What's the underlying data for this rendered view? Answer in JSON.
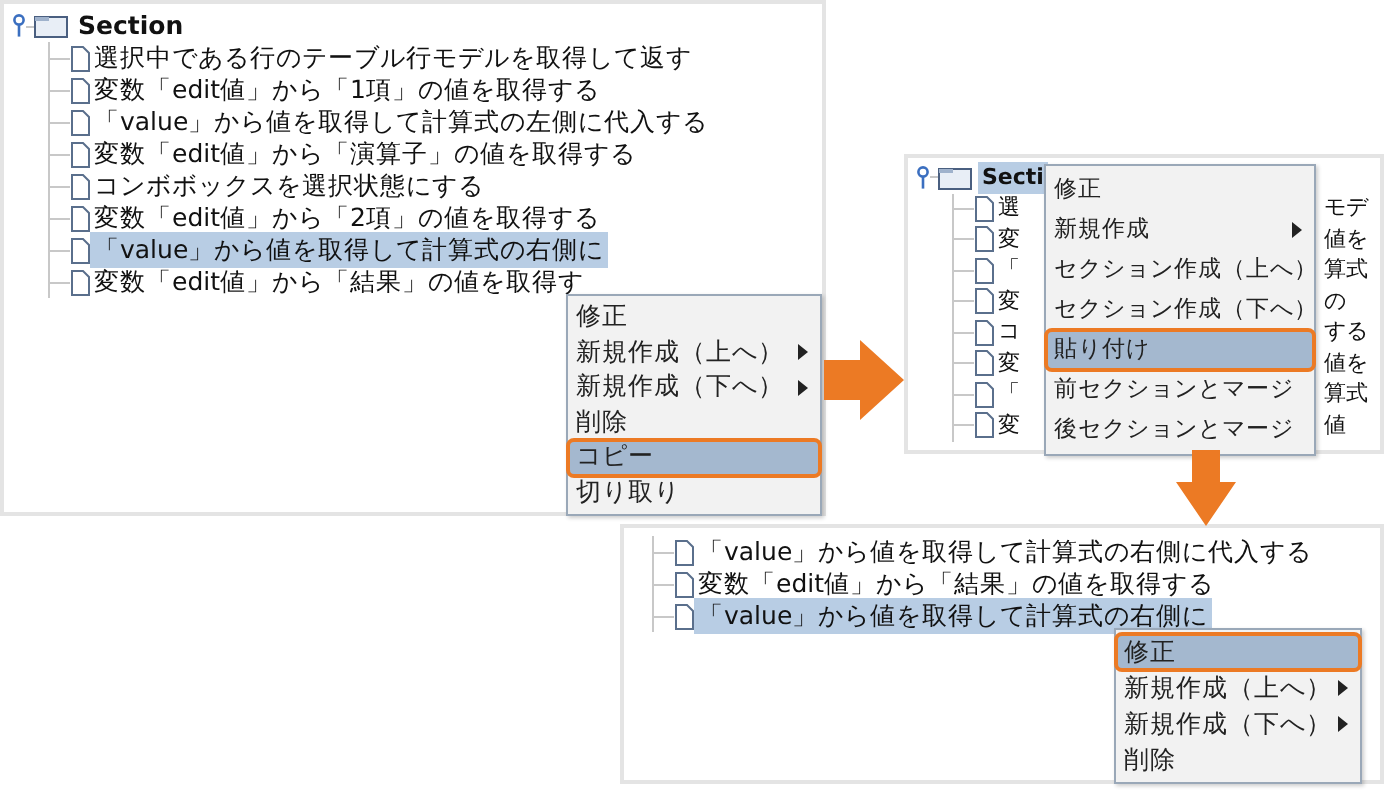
{
  "panels": [
    {
      "tree": {
        "root": {
          "label": "Section",
          "selected": false
        },
        "children": [
          {
            "label": "選択中である行のテーブル行モデルを取得して返す",
            "selected": false
          },
          {
            "label": "変数「edit値」から「1項」の値を取得する",
            "selected": false
          },
          {
            "label": "「value」から値を取得して計算式の左側に代入する",
            "selected": false
          },
          {
            "label": "変数「edit値」から「演算子」の値を取得する",
            "selected": false
          },
          {
            "label": "コンボボックスを選択状態にする",
            "selected": false
          },
          {
            "label": "変数「edit値」から「2項」の値を取得する",
            "selected": false
          },
          {
            "label": "「value」から値を取得して計算式の右側に",
            "selected": true
          },
          {
            "label": "変数「edit値」から「結果」の値を取得す",
            "selected": false
          }
        ]
      },
      "context_menu": {
        "items": [
          {
            "label": "修正",
            "submenu": false,
            "selected": false,
            "outlined": false
          },
          {
            "label": "新規作成（上へ）",
            "submenu": true,
            "selected": false,
            "outlined": false
          },
          {
            "label": "新規作成（下へ）",
            "submenu": true,
            "selected": false,
            "outlined": false
          },
          {
            "label": "削除",
            "submenu": false,
            "selected": false,
            "outlined": false
          },
          {
            "label": "コピー",
            "submenu": false,
            "selected": true,
            "outlined": true
          },
          {
            "label": "切り取り",
            "submenu": false,
            "selected": false,
            "outlined": false
          }
        ]
      }
    },
    {
      "tree": {
        "root": {
          "segments": [
            "Secti"
          ],
          "selected": true
        },
        "children": [
          {
            "segments": [
              "選",
              "モデ"
            ],
            "selected": false
          },
          {
            "segments": [
              "変",
              "値を"
            ],
            "selected": false
          },
          {
            "segments": [
              "「",
              "算式"
            ],
            "selected": false
          },
          {
            "segments": [
              "変",
              "の"
            ],
            "selected": false
          },
          {
            "segments": [
              "コ",
              "する"
            ],
            "selected": false
          },
          {
            "segments": [
              "変",
              "値を"
            ],
            "selected": false
          },
          {
            "segments": [
              "「",
              "算式"
            ],
            "selected": false
          },
          {
            "segments": [
              "変",
              "値"
            ],
            "selected": false
          }
        ]
      },
      "context_menu": {
        "items": [
          {
            "label": "修正",
            "submenu": false,
            "selected": false,
            "outlined": false
          },
          {
            "label": "新規作成",
            "submenu": true,
            "selected": false,
            "outlined": false
          },
          {
            "label": "セクション作成（上へ）",
            "submenu": false,
            "selected": false,
            "outlined": false
          },
          {
            "label": "セクション作成（下へ）",
            "submenu": false,
            "selected": false,
            "outlined": false
          },
          {
            "label": "貼り付け",
            "submenu": false,
            "selected": true,
            "outlined": true
          },
          {
            "label": "前セクションとマージ",
            "submenu": false,
            "selected": false,
            "outlined": false
          },
          {
            "label": "後セクションとマージ",
            "submenu": false,
            "selected": false,
            "outlined": false
          }
        ]
      }
    },
    {
      "tree": {
        "children": [
          {
            "label": "「value」から値を取得して計算式の右側に代入する",
            "selected": false
          },
          {
            "label": "変数「edit値」から「結果」の値を取得する",
            "selected": false
          },
          {
            "label": "「value」から値を取得して計算式の右側に",
            "selected": true
          }
        ]
      },
      "context_menu": {
        "items": [
          {
            "label": "修正",
            "submenu": false,
            "selected": true,
            "outlined": true
          },
          {
            "label": "新規作成（上へ）",
            "submenu": true,
            "selected": false,
            "outlined": false
          },
          {
            "label": "新規作成（下へ）",
            "submenu": true,
            "selected": false,
            "outlined": false
          },
          {
            "label": "削除",
            "submenu": false,
            "selected": false,
            "outlined": false
          }
        ]
      }
    }
  ],
  "arrows": [
    {
      "kind": "right"
    },
    {
      "kind": "down"
    }
  ]
}
